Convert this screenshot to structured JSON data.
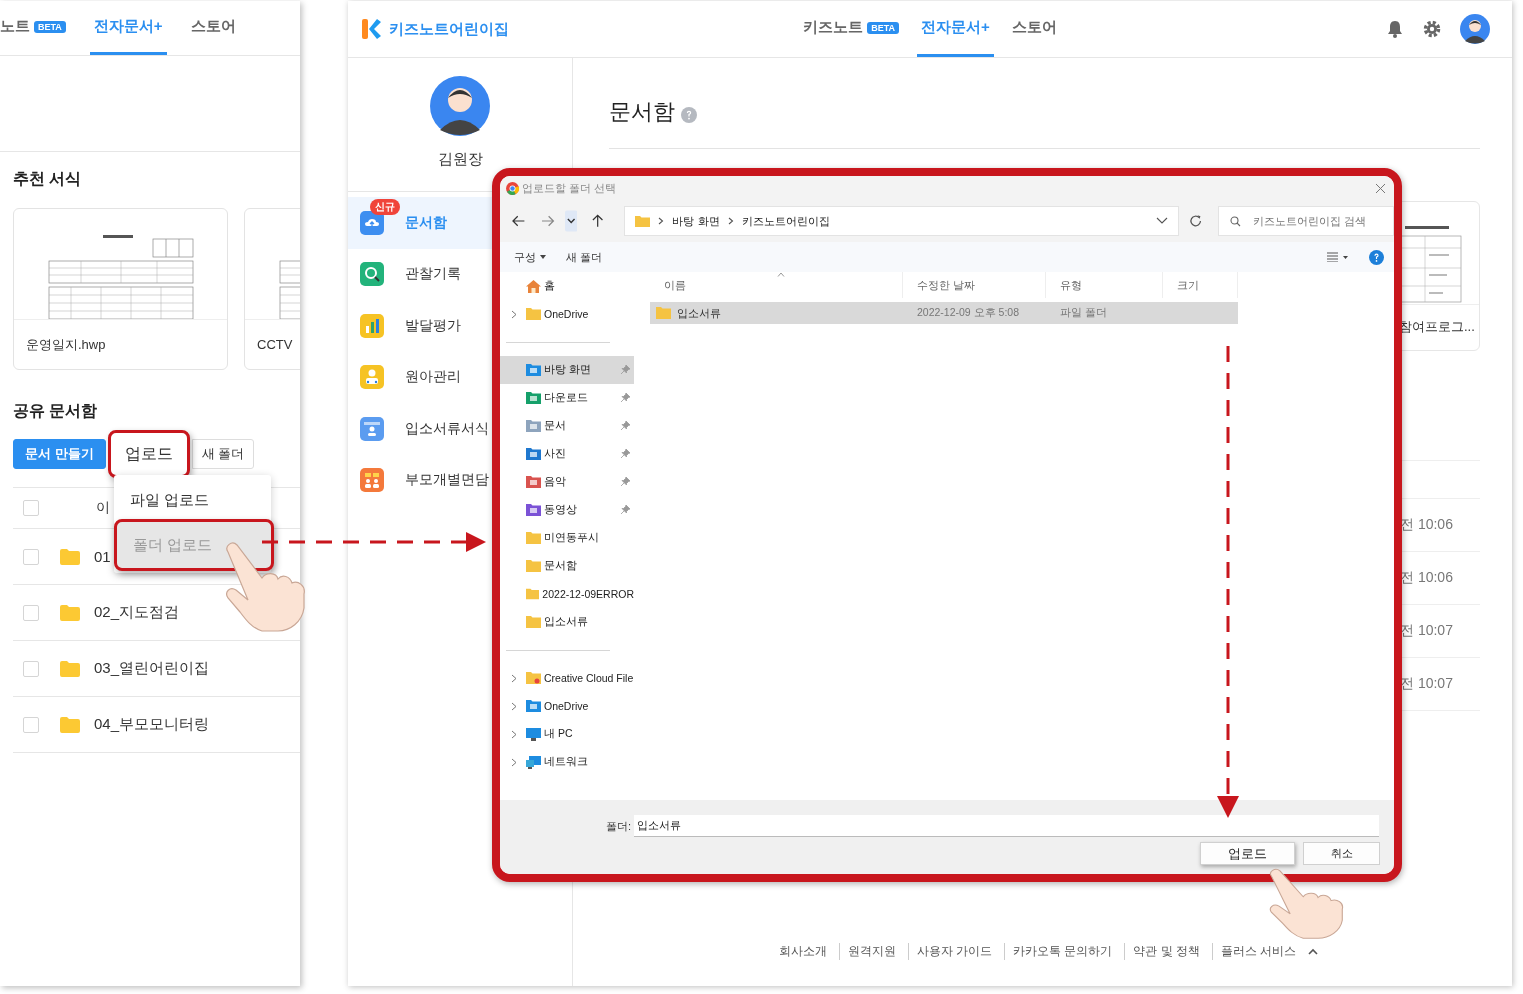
{
  "left_panel": {
    "tabs": [
      {
        "label": "노트",
        "badge": "BETA",
        "selected": false
      },
      {
        "label": "전자문서+",
        "selected": true
      },
      {
        "label": "스토어",
        "selected": false
      }
    ],
    "recommended": {
      "title": "추천 서식",
      "cards": [
        {
          "name": "운영일지.hwp"
        },
        {
          "name": "CCTV"
        }
      ]
    },
    "shared": {
      "title": "공유 문서함",
      "buttons": [
        {
          "label": "문서 만들기",
          "kind": "primary",
          "highlighted": false
        },
        {
          "label": "업로드",
          "kind": "default",
          "highlighted": true
        },
        {
          "label": "새 폴더",
          "kind": "default",
          "highlighted": false
        }
      ],
      "menu": [
        {
          "label": "파일 업로드",
          "highlighted": false
        },
        {
          "label": "폴더 업로드",
          "highlighted": true
        }
      ],
      "header": {
        "label": "이",
        "checked": false
      },
      "rows": [
        {
          "name": "01",
          "checked": false
        },
        {
          "name": "02_지도점검",
          "checked": false
        },
        {
          "name": "03_열린어린이집",
          "checked": false
        },
        {
          "name": "04_부모모니터링",
          "checked": false
        }
      ]
    }
  },
  "right_panel": {
    "logo": "키즈노트어린이집",
    "tabs": [
      {
        "label": "키즈노트",
        "badge": "BETA",
        "selected": false
      },
      {
        "label": "전자문서+",
        "selected": true
      },
      {
        "label": "스토어",
        "selected": false
      }
    ],
    "user": "김원장",
    "menu": [
      {
        "label": "문서함",
        "badge": "신규",
        "kind": "docs",
        "color": "#3d8ef0",
        "selected": true
      },
      {
        "label": "관찰기록",
        "kind": "observe",
        "color": "#22b37b",
        "selected": false
      },
      {
        "label": "발달평가",
        "kind": "chart",
        "color": "#f6c324",
        "selected": false
      },
      {
        "label": "원아관리",
        "kind": "child",
        "color": "#f6c324",
        "selected": false
      },
      {
        "label": "입소서류서식",
        "kind": "form",
        "color": "#5b9cf0",
        "selected": false
      },
      {
        "label": "부모개별면담",
        "kind": "meeting",
        "color": "#f4793b",
        "selected": false
      }
    ],
    "title": "문서함",
    "card": "참여프로그...",
    "times": [
      "전 10:06",
      "전 10:06",
      "전 10:07",
      "전 10:07"
    ],
    "footer": [
      "회사소개",
      "원격지원",
      "사용자 가이드",
      "카카오톡 문의하기",
      "약관 및 정책",
      "플러스 서비스"
    ]
  },
  "dialog": {
    "title": "업로드할 폴더 선택",
    "breadcrumb": [
      "바탕 화면",
      "키즈노트어린이집"
    ],
    "search": {
      "placeholder": "키즈노트어린이집 검색"
    },
    "toolbar": [
      "구성",
      "새 폴더"
    ],
    "nav_groups": [
      [
        {
          "label": "홈",
          "kind": "home",
          "expandable": false,
          "pinned": false,
          "selected": false
        },
        {
          "label": "OneDrive",
          "kind": "folder",
          "expandable": true,
          "pinned": false,
          "selected": false
        }
      ],
      [
        {
          "label": "바탕 화면",
          "kind": "desktop",
          "expandable": false,
          "pinned": true,
          "selected": true
        },
        {
          "label": "다운로드",
          "kind": "download",
          "expandable": false,
          "pinned": true,
          "selected": false
        },
        {
          "label": "문서",
          "kind": "documents",
          "expandable": false,
          "pinned": true,
          "selected": false
        },
        {
          "label": "사진",
          "kind": "pictures",
          "expandable": false,
          "pinned": true,
          "selected": false
        },
        {
          "label": "음악",
          "kind": "music",
          "expandable": false,
          "pinned": true,
          "selected": false
        },
        {
          "label": "동영상",
          "kind": "videos",
          "expandable": false,
          "pinned": true,
          "selected": false
        },
        {
          "label": "미연동푸시",
          "kind": "folder",
          "expandable": false,
          "pinned": false,
          "selected": false
        },
        {
          "label": "문서함",
          "kind": "folder",
          "expandable": false,
          "pinned": false,
          "selected": false
        },
        {
          "label": "2022-12-09ERROR",
          "kind": "folder",
          "expandable": false,
          "pinned": false,
          "selected": false
        },
        {
          "label": "입소서류",
          "kind": "folder",
          "expandable": false,
          "pinned": false,
          "selected": false
        }
      ],
      [
        {
          "label": "Creative Cloud File",
          "kind": "cloud",
          "expandable": true,
          "pinned": false,
          "selected": false
        },
        {
          "label": "OneDrive",
          "kind": "onedrive",
          "expandable": true,
          "pinned": false,
          "selected": false
        },
        {
          "label": "내 PC",
          "kind": "pc",
          "expandable": true,
          "pinned": false,
          "selected": false
        },
        {
          "label": "네트워크",
          "kind": "network",
          "expandable": true,
          "pinned": false,
          "selected": false
        }
      ]
    ],
    "columns": [
      "이름",
      "수정한 날짜",
      "유형",
      "크기"
    ],
    "files": [
      {
        "name": "입소서류",
        "date": "2022-12-09 오후 5:08",
        "type": "파일 폴더",
        "selected": true
      }
    ],
    "folder_label": "폴더:",
    "folder_value": "입소서류",
    "buttons": [
      {
        "label": "업로드",
        "highlighted": true
      },
      {
        "label": "취소",
        "highlighted": false
      }
    ]
  }
}
